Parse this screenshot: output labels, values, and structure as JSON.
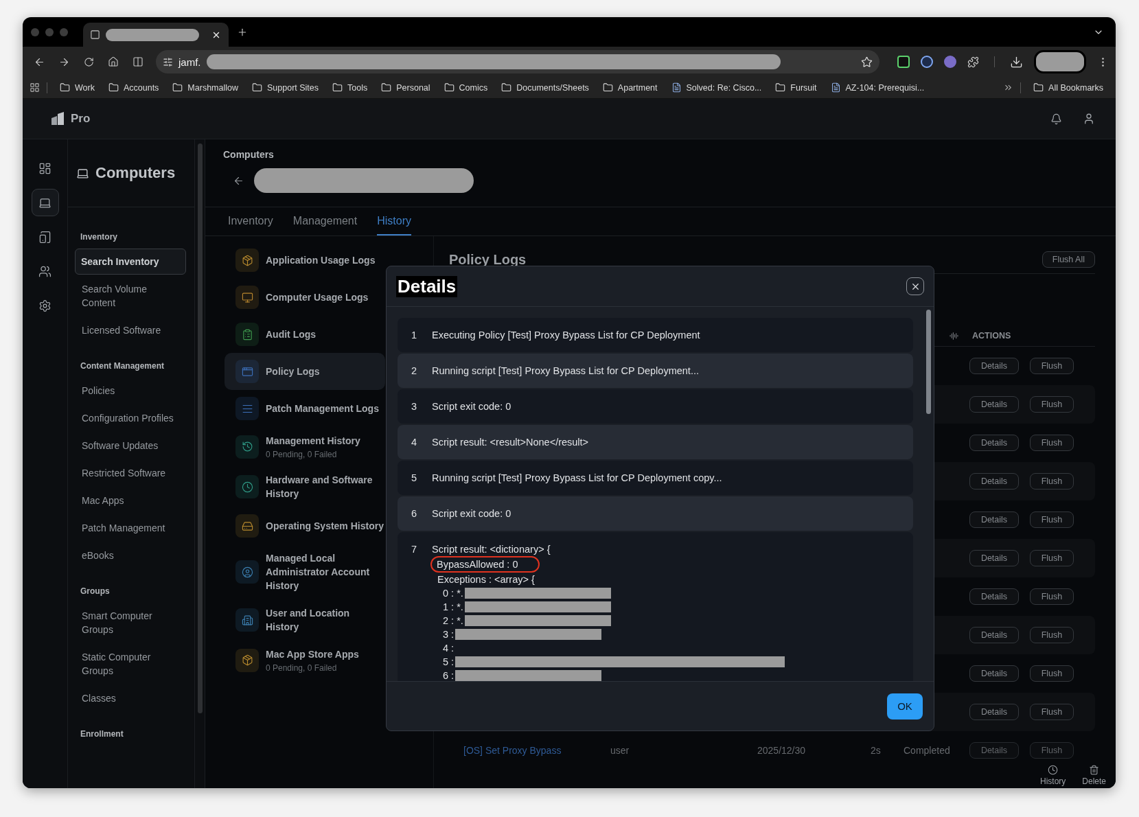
{
  "browser": {
    "tab_title_redacted": true,
    "url": "jamf.",
    "bookmarks": [
      {
        "label": "Work",
        "kind": "folder"
      },
      {
        "label": "Accounts",
        "kind": "folder"
      },
      {
        "label": "Marshmallow",
        "kind": "folder"
      },
      {
        "label": "Support Sites",
        "kind": "folder"
      },
      {
        "label": "Tools",
        "kind": "folder"
      },
      {
        "label": "Personal",
        "kind": "folder"
      },
      {
        "label": "Comics",
        "kind": "folder"
      },
      {
        "label": "Documents/Sheets",
        "kind": "folder"
      },
      {
        "label": "Apartment",
        "kind": "folder"
      },
      {
        "label": "Solved: Re: Cisco...",
        "kind": "page"
      },
      {
        "label": "Fursuit",
        "kind": "folder"
      },
      {
        "label": "AZ-104: Prerequisi...",
        "kind": "page"
      }
    ],
    "all_bookmarks": "All Bookmarks"
  },
  "app": {
    "product": "Pro"
  },
  "rail": [
    {
      "selected": false
    },
    {
      "selected": true
    },
    {
      "selected": false
    },
    {
      "selected": false
    },
    {
      "selected": false
    }
  ],
  "sidebar": {
    "title": "Computers",
    "sections": [
      {
        "heading": "Inventory",
        "items": [
          {
            "label": "Search Inventory",
            "selected": true
          },
          {
            "label": "Search Volume Content",
            "selected": false
          },
          {
            "label": "Licensed Software",
            "selected": false
          }
        ]
      },
      {
        "heading": "Content Management",
        "items": [
          {
            "label": "Policies",
            "selected": false
          },
          {
            "label": "Configuration Profiles",
            "selected": false
          },
          {
            "label": "Software Updates",
            "selected": false
          },
          {
            "label": "Restricted Software",
            "selected": false
          },
          {
            "label": "Mac Apps",
            "selected": false
          },
          {
            "label": "Patch Management",
            "selected": false
          },
          {
            "label": "eBooks",
            "selected": false
          }
        ]
      },
      {
        "heading": "Groups",
        "items": [
          {
            "label": "Smart Computer Groups",
            "selected": false
          },
          {
            "label": "Static Computer Groups",
            "selected": false
          },
          {
            "label": "Classes",
            "selected": false
          }
        ]
      },
      {
        "heading": "Enrollment"
      }
    ]
  },
  "breadcrumb": "Computers",
  "tabs": [
    {
      "label": "Inventory",
      "selected": false
    },
    {
      "label": "Management",
      "selected": false
    },
    {
      "label": "History",
      "selected": true
    }
  ],
  "history_categories": [
    {
      "label": "Application Usage Logs",
      "color": "#b88a2e",
      "selected": false
    },
    {
      "label": "Computer Usage Logs",
      "color": "#b8862e",
      "selected": false
    },
    {
      "label": "Audit Logs",
      "color": "#3f9a4e",
      "selected": false
    },
    {
      "label": "Policy Logs",
      "color": "#3c6fb8",
      "selected": true
    },
    {
      "label": "Patch Management Logs",
      "color": "#3c6fb8",
      "selected": false
    },
    {
      "label": "Management History",
      "sub": "0 Pending, 0 Failed",
      "color": "#2f9a86",
      "selected": false
    },
    {
      "label": "Hardware and Software History",
      "color": "#2f9a86",
      "selected": false
    },
    {
      "label": "Operating System History",
      "color": "#b88a2e",
      "selected": false
    },
    {
      "label": "Managed Local Administrator Account History",
      "color": "#3c7fb0",
      "selected": false
    },
    {
      "label": "User and Location History",
      "color": "#3c7fb0",
      "selected": false
    },
    {
      "label": "Mac App Store Apps",
      "sub": "0 Pending, 0 Failed",
      "color": "#b88a2e",
      "selected": false
    }
  ],
  "policy_logs": {
    "title": "Policy Logs",
    "flush_all": "Flush All",
    "actions_heading": "ACTIONS",
    "rows": [
      {
        "actions": [
          "Details",
          "Flush"
        ]
      },
      {
        "actions": [
          "Details",
          "Flush"
        ]
      },
      {
        "actions": [
          "Details",
          "Flush"
        ]
      },
      {
        "actions": [
          "Details",
          "Flush"
        ]
      },
      {
        "actions": [
          "Details",
          "Flush"
        ]
      },
      {
        "actions": [
          "Details",
          "Flush"
        ]
      },
      {
        "actions": [
          "Details",
          "Flush"
        ]
      },
      {
        "actions": [
          "Details",
          "Flush"
        ]
      },
      {
        "actions": [
          "Details",
          "Flush"
        ]
      },
      {
        "actions": [
          "Details",
          "Flush"
        ]
      },
      {
        "name": "[OS] Set Proxy Bypass",
        "user": "user",
        "date": "2025/12/30",
        "duration": "2s",
        "status": "Completed",
        "actions": [
          "Details",
          "Flush"
        ]
      }
    ]
  },
  "bulk_actions": [
    {
      "label": "History",
      "kind": "history"
    },
    {
      "label": "Delete",
      "kind": "delete"
    }
  ],
  "dialog": {
    "title": "Details",
    "ok": "OK",
    "lines": [
      {
        "number": "1",
        "text": "Executing Policy [Test] Proxy Bypass List for CP Deployment"
      },
      {
        "number": "2",
        "text": "Running script [Test] Proxy Bypass List for CP Deployment..."
      },
      {
        "number": "3",
        "text": "Script exit code: 0"
      },
      {
        "number": "4",
        "text": "Script result: <result>None</result>"
      },
      {
        "number": "5",
        "text": "Running script [Test] Proxy Bypass List for CP Deployment copy..."
      },
      {
        "number": "6",
        "text": "Script exit code: 0"
      },
      {
        "number": "7",
        "text": "Script result: <dictionary> {",
        "children": [
          {
            "text": "BypassAllowed : 0",
            "highlighted": true
          },
          {
            "text": "Exceptions : <array> {",
            "highlighted": false,
            "children": [
              {
                "text": "0 : *.",
                "kind": "redacted"
              },
              {
                "text": "1 : *.",
                "kind": "redacted"
              },
              {
                "text": "2 : *.",
                "kind": "redacted"
              },
              {
                "text": "3 :",
                "kind": "redacted"
              },
              {
                "text": "4 :",
                "kind": "plain"
              },
              {
                "text": "5 :",
                "kind": "redactedlong"
              },
              {
                "text": "6 :",
                "kind": "redacted"
              }
            ]
          }
        ]
      }
    ]
  }
}
